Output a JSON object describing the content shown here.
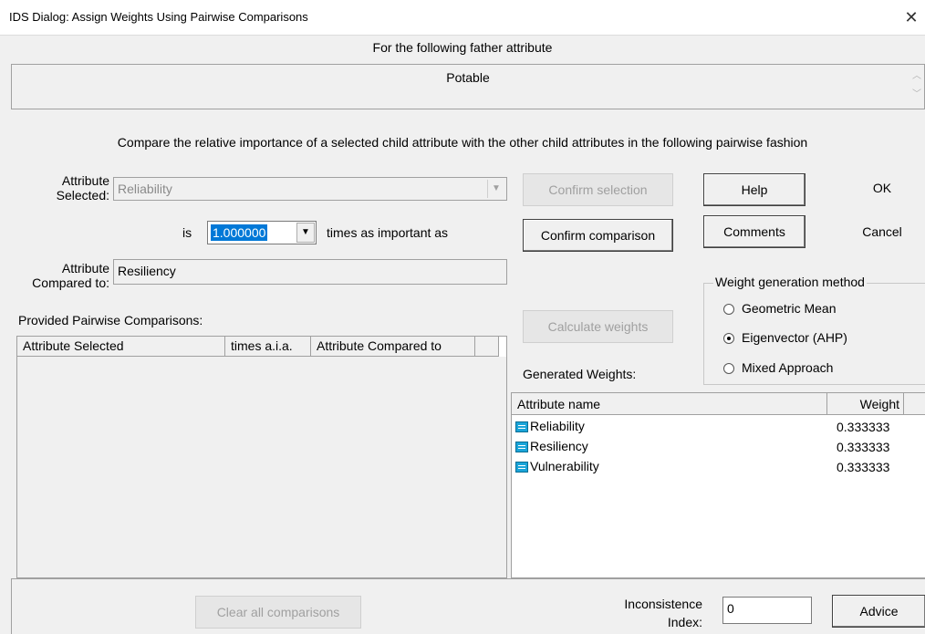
{
  "window": {
    "title": "IDS Dialog: Assign Weights Using Pairwise Comparisons",
    "close_glyph": "✕"
  },
  "father": {
    "caption": "For the following father attribute",
    "value": "Potable"
  },
  "instructions": "Compare the relative importance of a selected child attribute with the other child attributes in the following pairwise fashion",
  "selected": {
    "label": "Attribute Selected:",
    "value": "Reliability"
  },
  "importance": {
    "is_label": "is",
    "value": "1.000000",
    "suffix": "times as important as"
  },
  "compared": {
    "label": "Attribute Compared to:",
    "value": "Resiliency"
  },
  "buttons": {
    "confirm_selection": "Confirm selection",
    "confirm_comparison": "Confirm comparison",
    "help": "Help",
    "ok": "OK",
    "comments": "Comments",
    "cancel": "Cancel",
    "calculate_weights": "Calculate weights",
    "clear_all": "Clear all comparisons",
    "advice": "Advice"
  },
  "pairwise": {
    "caption": "Provided Pairwise Comparisons:",
    "columns": [
      "Attribute Selected",
      "times a.i.a.",
      "Attribute Compared to"
    ]
  },
  "method": {
    "legend": "Weight generation method",
    "options": [
      "Geometric Mean",
      "Eigenvector (AHP)",
      "Mixed Approach"
    ],
    "selected": "Eigenvector (AHP)"
  },
  "weights": {
    "caption": "Generated Weights:",
    "columns": [
      "Attribute name",
      "Weight"
    ],
    "rows": [
      {
        "name": "Reliability",
        "weight": "0.333333"
      },
      {
        "name": "Resiliency",
        "weight": "0.333333"
      },
      {
        "name": "Vulnerability",
        "weight": "0.333333"
      }
    ]
  },
  "inconsistence": {
    "label": "Inconsistence Index:",
    "value": "0"
  }
}
